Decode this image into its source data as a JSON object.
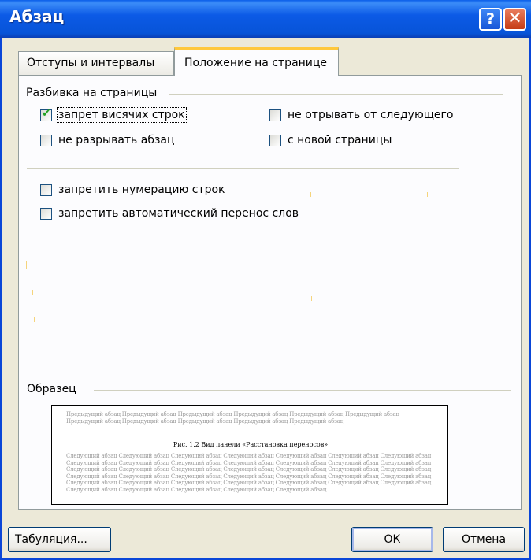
{
  "window": {
    "title": "Абзац",
    "help_label": "?",
    "close_label": "✕"
  },
  "tabs": [
    {
      "label": "Отступы и интервалы",
      "active": false
    },
    {
      "label": "Положение на странице",
      "active": true
    }
  ],
  "pagination": {
    "heading": "Разбивка на страницы",
    "options": [
      {
        "label": "запрет висячих строк",
        "checked": true
      },
      {
        "label": "не отрывать от следующего",
        "checked": false
      },
      {
        "label": "не разрывать абзац",
        "checked": false
      },
      {
        "label": "с новой страницы",
        "checked": false
      }
    ]
  },
  "other_options": [
    {
      "label": "запретить нумерацию строк",
      "checked": false
    },
    {
      "label": "запретить автоматический перенос слов",
      "checked": false
    }
  ],
  "sample": {
    "heading": "Образец",
    "previous_text": "Предыдущий абзац Предыдущий абзац Предыдущий абзац Предыдущий абзац Предыдущий абзац Предыдущий абзац Предыдущий абзац Предыдущий абзац Предыдущий абзац Предыдущий абзац Предыдущий абзац",
    "caption": "Рис. 1.2 Вид панели «Расстановка переносов»",
    "following_text": "Следующий абзац Следующий абзац Следующий абзац Следующий абзац Следующий абзац Следующий абзац Следующий абзац Следующий абзац Следующий абзац Следующий абзац Следующий абзац Следующий абзац Следующий абзац Следующий абзац Следующий абзац Следующий абзац Следующий абзац Следующий абзац Следующий абзац Следующий абзац Следующий абзац Следующий абзац Следующий абзац Следующий абзац Следующий абзац Следующий абзац Следующий абзац Следующий абзац Следующий абзац Следующий абзац Следующий абзац Следующий абзац Следующий абзац Следующий абзац Следующий абзац Следующий абзац Следующий абзац Следующий абзац Следующий абзац Следующий абзац"
  },
  "buttons": {
    "tabs_button": "Табуляция...",
    "ok": "ОК",
    "cancel": "Отмена"
  },
  "colors": {
    "titlebar": "#0a5ee9",
    "dialog_bg": "#ece9d8",
    "active_tab_accent": "#ffc83c",
    "close_button": "#c53c15",
    "checkmark": "#21a121"
  }
}
